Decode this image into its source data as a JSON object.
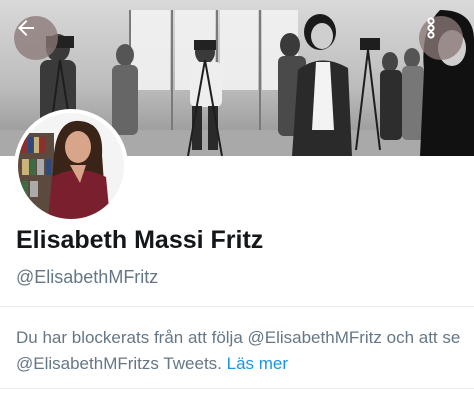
{
  "profile": {
    "display_name": "Elisabeth Massi Fritz",
    "handle": "@ElisabethMFritz"
  },
  "notice": {
    "text": "Du har blockerats från att följa @ElisabethMFritz och att se @ElisabethMFritzs Tweets.",
    "link_label": "Läs mer"
  },
  "icons": {
    "back": "arrow-left-icon",
    "more": "more-vertical-icon"
  },
  "colors": {
    "link": "#1b95e0",
    "secondary_text": "#657786",
    "primary_text": "#14171a",
    "divider": "#e6ecf0"
  }
}
